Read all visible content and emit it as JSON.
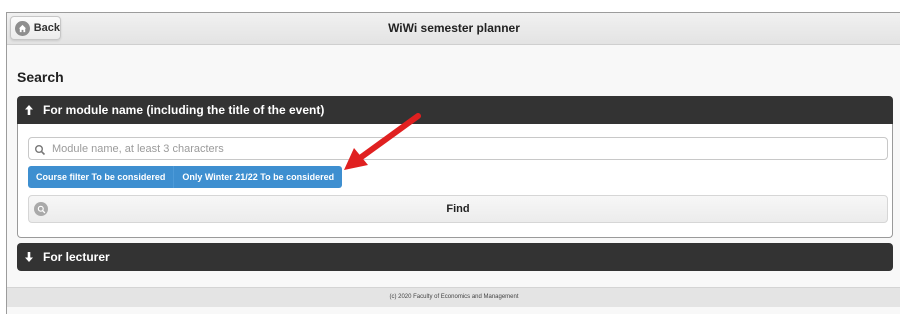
{
  "header": {
    "back_label": "Back",
    "title": "WiWi semester planner"
  },
  "search": {
    "heading": "Search",
    "module_section": {
      "label": "For module name (including the title of the event)",
      "placeholder": "Module name, at least 3 characters",
      "value": "",
      "filters": [
        "Course filter To be considered",
        "Only Winter 21/22 To be considered"
      ],
      "find_label": "Find"
    },
    "lecturer_section": {
      "label": "For lecturer"
    }
  },
  "footer": {
    "text": "(c) 2020 Faculty of Economics and Management"
  },
  "colors": {
    "header_dark": "#333333",
    "filter_blue": "#3e8fd0",
    "annotation_red": "#e02020"
  },
  "icons": {
    "back": "home-icon",
    "search": "search-icon",
    "find": "magnifier-icon",
    "expand_open": "arrow-up-icon",
    "expand_closed": "arrow-down-icon"
  }
}
